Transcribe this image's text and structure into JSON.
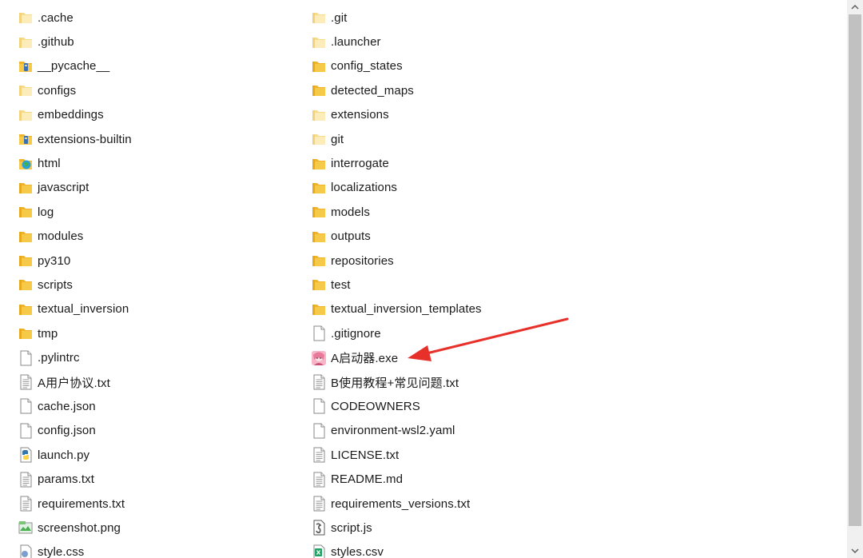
{
  "files_left": [
    {
      "label": ".cache",
      "icon": "folder-light-icon"
    },
    {
      "label": ".github",
      "icon": "folder-light-icon"
    },
    {
      "label": "__pycache__",
      "icon": "folder-special-icon"
    },
    {
      "label": "configs",
      "icon": "folder-light-icon"
    },
    {
      "label": "embeddings",
      "icon": "folder-light-icon"
    },
    {
      "label": "extensions-builtin",
      "icon": "folder-special-icon"
    },
    {
      "label": "html",
      "icon": "folder-html-icon"
    },
    {
      "label": "javascript",
      "icon": "folder-icon"
    },
    {
      "label": "log",
      "icon": "folder-icon"
    },
    {
      "label": "modules",
      "icon": "folder-icon"
    },
    {
      "label": "py310",
      "icon": "folder-icon"
    },
    {
      "label": "scripts",
      "icon": "folder-icon"
    },
    {
      "label": "textual_inversion",
      "icon": "folder-icon"
    },
    {
      "label": "tmp",
      "icon": "folder-icon"
    },
    {
      "label": ".pylintrc",
      "icon": "file-blank-icon"
    },
    {
      "label": "A用户协议.txt",
      "icon": "file-text-icon"
    },
    {
      "label": "cache.json",
      "icon": "file-blank-icon"
    },
    {
      "label": "config.json",
      "icon": "file-blank-icon"
    },
    {
      "label": "launch.py",
      "icon": "python-file-icon"
    },
    {
      "label": "params.txt",
      "icon": "file-text-icon"
    },
    {
      "label": "requirements.txt",
      "icon": "file-text-icon"
    },
    {
      "label": "screenshot.png",
      "icon": "image-file-icon"
    },
    {
      "label": "style.css",
      "icon": "css-file-icon"
    }
  ],
  "files_right": [
    {
      "label": ".git",
      "icon": "folder-light-icon"
    },
    {
      "label": ".launcher",
      "icon": "folder-light-icon"
    },
    {
      "label": "config_states",
      "icon": "folder-icon"
    },
    {
      "label": "detected_maps",
      "icon": "folder-icon"
    },
    {
      "label": "extensions",
      "icon": "folder-light-icon"
    },
    {
      "label": "git",
      "icon": "folder-light-icon"
    },
    {
      "label": "interrogate",
      "icon": "folder-icon"
    },
    {
      "label": "localizations",
      "icon": "folder-icon"
    },
    {
      "label": "models",
      "icon": "folder-icon"
    },
    {
      "label": "outputs",
      "icon": "folder-icon"
    },
    {
      "label": "repositories",
      "icon": "folder-icon"
    },
    {
      "label": "test",
      "icon": "folder-icon"
    },
    {
      "label": "textual_inversion_templates",
      "icon": "folder-icon"
    },
    {
      "label": ".gitignore",
      "icon": "file-blank-icon"
    },
    {
      "label": "A启动器.exe",
      "icon": "launcher-exe-icon"
    },
    {
      "label": "B使用教程+常见问题.txt",
      "icon": "file-text-icon"
    },
    {
      "label": "CODEOWNERS",
      "icon": "file-blank-icon"
    },
    {
      "label": "environment-wsl2.yaml",
      "icon": "file-blank-icon"
    },
    {
      "label": "LICENSE.txt",
      "icon": "file-text-icon"
    },
    {
      "label": "README.md",
      "icon": "file-text-icon"
    },
    {
      "label": "requirements_versions.txt",
      "icon": "file-text-icon"
    },
    {
      "label": "script.js",
      "icon": "js-file-icon"
    },
    {
      "label": "styles.csv",
      "icon": "csv-file-icon"
    }
  ],
  "annotation": {
    "type": "red-arrow",
    "points_to": "A启动器.exe",
    "color": "#e8302a"
  },
  "colors": {
    "folder": "#f7c948",
    "folder_light": "#fbe7a6",
    "text": "#1a1a1a",
    "background": "#ffffff",
    "scrollbar_track": "#f0f0f0",
    "scrollbar_thumb": "#c1c1c1"
  }
}
